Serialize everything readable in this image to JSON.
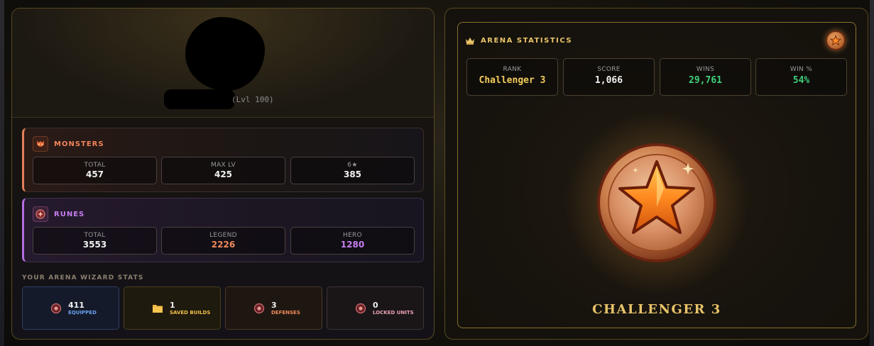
{
  "profile": {
    "level": "(Lvl 100)"
  },
  "monsters": {
    "title": "MONSTERS",
    "stats": [
      {
        "label": "TOTAL",
        "value": "457"
      },
      {
        "label": "MAX LV",
        "value": "425"
      },
      {
        "label": "6★",
        "value": "385"
      }
    ],
    "accent": "#f0845a"
  },
  "runes": {
    "title": "RUNES",
    "stats": [
      {
        "label": "TOTAL",
        "value": "3553",
        "color": "#f0f0f0"
      },
      {
        "label": "LEGEND",
        "value": "2226",
        "color": "#f08a5a"
      },
      {
        "label": "HERO",
        "value": "1280",
        "color": "#c77ef0"
      }
    ],
    "accent": "#c77ef0"
  },
  "wizard": {
    "title": "YOUR ARENA WIZARD STATS",
    "items": [
      {
        "value": "411",
        "label": "EQUIPPED",
        "icon": "rune-icon"
      },
      {
        "value": "1",
        "label": "SAVED BUILDS",
        "icon": "folder-icon"
      },
      {
        "value": "3",
        "label": "DEFENSES",
        "icon": "rune-icon"
      },
      {
        "value": "0",
        "label": "LOCKED UNITS",
        "icon": "rune-icon"
      }
    ]
  },
  "arena": {
    "title": "ARENA STATISTICS",
    "stats": [
      {
        "label": "RANK",
        "value": "Challenger 3",
        "color": "#f2cc5c"
      },
      {
        "label": "SCORE",
        "value": "1,066",
        "color": "#f0f0f0"
      },
      {
        "label": "WINS",
        "value": "29,761",
        "color": "#3fd07a"
      },
      {
        "label": "WIN %",
        "value": "54%",
        "color": "#3fd07a"
      }
    ],
    "rank_name": "CHALLENGER 3"
  }
}
